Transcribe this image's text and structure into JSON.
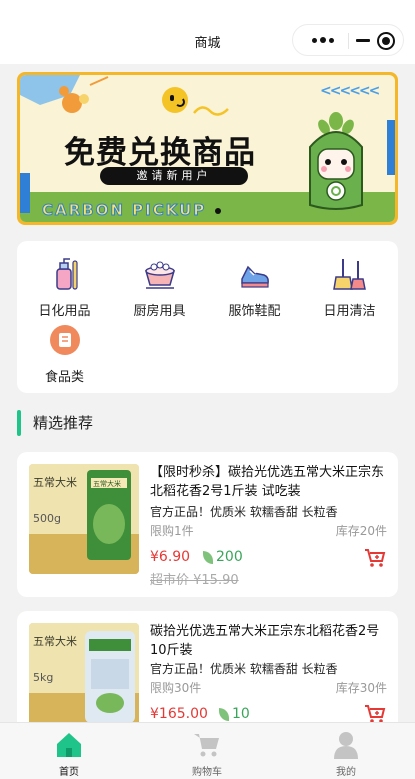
{
  "navbar": {
    "title": "商城"
  },
  "banner": {
    "title": "免费兑换商品",
    "subtitle": "邀请新用户",
    "brand": "CARBON PICKUP",
    "chevrons": "<<<<<<"
  },
  "categories": [
    {
      "label": "日化用品",
      "icon": "toiletries-icon"
    },
    {
      "label": "厨房用具",
      "icon": "kitchenware-icon"
    },
    {
      "label": "服饰鞋配",
      "icon": "shoe-icon"
    },
    {
      "label": "日用清洁",
      "icon": "cleaning-icon"
    },
    {
      "label": "食品类",
      "icon": "food-icon"
    }
  ],
  "section": {
    "title": "精选推荐"
  },
  "products": [
    {
      "name": "【限时秒杀】碳拾光优选五常大米正宗东北稻花香2号1斤装 试吃装",
      "desc": "官方正品！优质米 软糯香甜 长粒香",
      "limit": "限购1件",
      "stock": "库存20件",
      "price": "¥6.90",
      "carbon": "200",
      "old_price": "超市价 ¥15.90",
      "image_text": "五常大米",
      "image_weight": "500g"
    },
    {
      "name": "碳拾光优选五常大米正宗东北稻花香2号10斤装",
      "desc": "官方正品！优质米 软糯香甜 长粒香",
      "limit": "限购30件",
      "stock": "库存30件",
      "price": "¥165.00",
      "carbon": "10",
      "image_text": "五常大米",
      "image_weight": "5kg"
    }
  ],
  "tabs": [
    {
      "label": "首页",
      "active": true
    },
    {
      "label": "购物车",
      "active": false
    },
    {
      "label": "我的",
      "active": false
    }
  ],
  "colors": {
    "accent_green": "#1fc48a",
    "price_red": "#e53935",
    "carbon_green": "#3aa55a",
    "banner_yellow": "#f4b72a"
  }
}
